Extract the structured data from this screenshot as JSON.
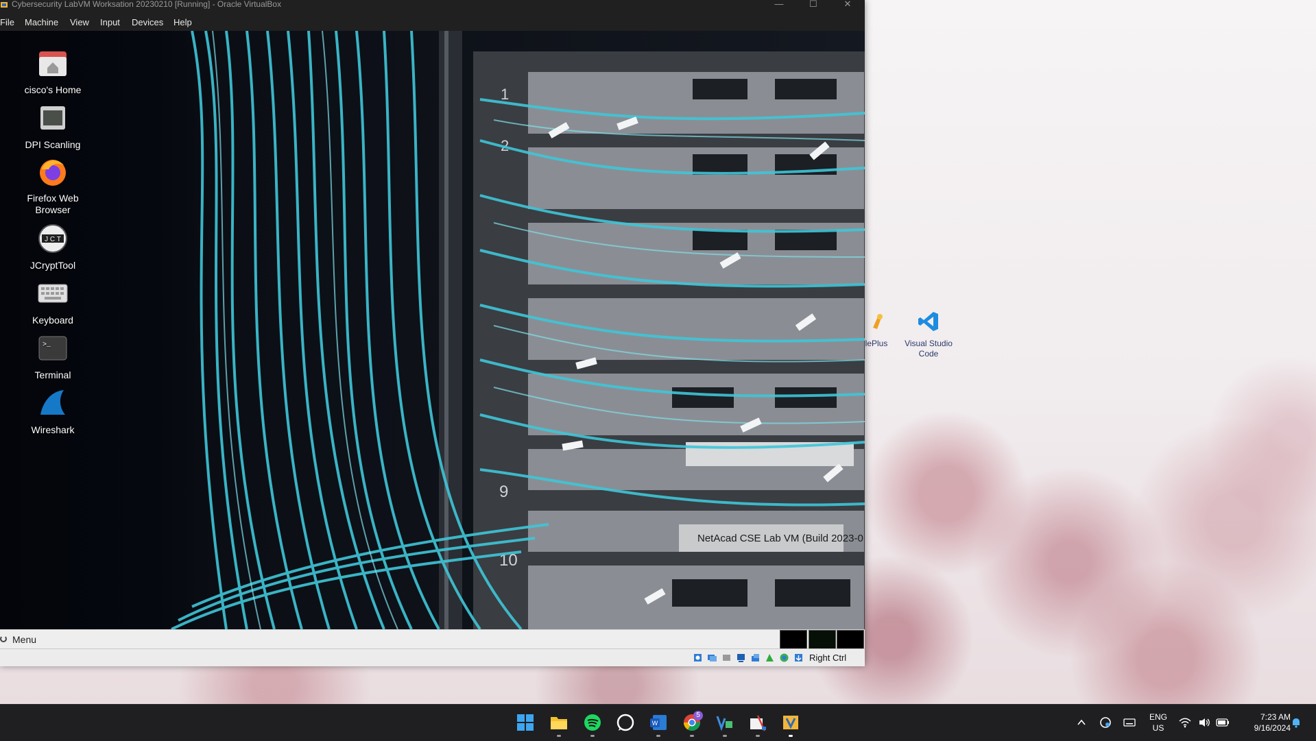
{
  "window": {
    "title": "Cybersecurity LabVM Worksation 20230210 [Running] - Oracle VirtualBox",
    "minimize_glyph": "—",
    "maximize_glyph": "☐",
    "close_glyph": "✕"
  },
  "menubar": {
    "items": [
      "File",
      "Machine",
      "View",
      "Input",
      "Devices",
      "Help"
    ]
  },
  "guest_desktop": {
    "icons": [
      {
        "label": "cisco's Home",
        "icon": "home-folder-icon"
      },
      {
        "label": "DPI Scanling",
        "icon": "image-folder-icon"
      },
      {
        "label": "Firefox Web Browser",
        "icon": "firefox-icon"
      },
      {
        "label": "JCryptTool",
        "icon": "jcrypttool-icon"
      },
      {
        "label": "Keyboard",
        "icon": "keyboard-icon"
      },
      {
        "label": "Terminal",
        "icon": "terminal-icon"
      },
      {
        "label": "Wireshark",
        "icon": "wireshark-icon"
      }
    ],
    "watermark": "NetAcad CSE Lab VM (Build 2023-0",
    "panel": {
      "menu_label": "Menu"
    }
  },
  "statusbar": {
    "host_key": "Right Ctrl"
  },
  "host_desktop": {
    "icons": [
      {
        "label": "lePlus",
        "icon": "app-icon"
      },
      {
        "label": "Visual Studio Code",
        "icon": "vscode-icon"
      }
    ]
  },
  "taskbar": {
    "apps": [
      "windows-start-icon",
      "file-explorer-icon",
      "spotify-icon",
      "whatsapp-icon",
      "word-icon",
      "chrome-icon",
      "virtualbox-icon",
      "snipping-tool-icon",
      "virtualbox-vm-icon"
    ],
    "chrome_badge": "5",
    "language": "ENG",
    "region": "US",
    "time": "7:23 AM",
    "date": "9/16/2024"
  },
  "colors": {
    "accent": "#0f76d6",
    "cable_cyan": "#3fc6d8",
    "titlebar_bg": "#202020"
  }
}
